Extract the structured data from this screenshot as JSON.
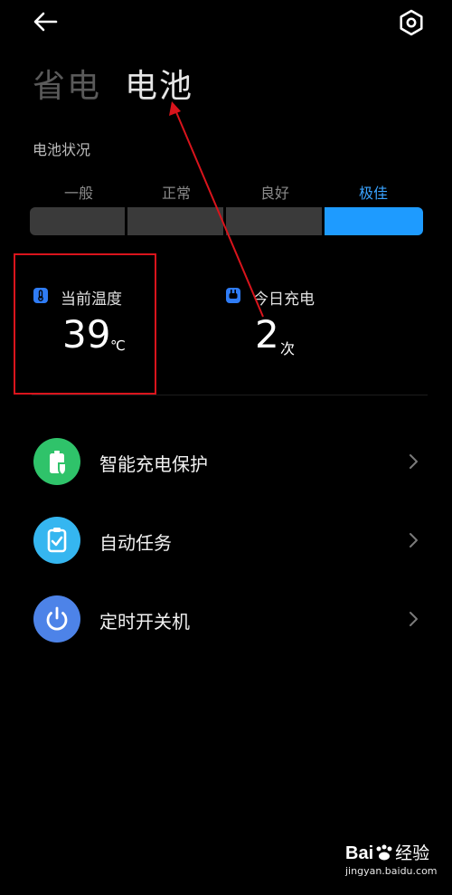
{
  "header": {
    "back_icon": "back-arrow-icon",
    "settings_icon": "gear-icon"
  },
  "tabs": [
    {
      "label": "省电",
      "active": false
    },
    {
      "label": "电池",
      "active": true
    }
  ],
  "battery_status": {
    "label": "电池状况",
    "levels": [
      "一般",
      "正常",
      "良好",
      "极佳"
    ],
    "selected": "极佳",
    "accent_color": "#1e9bff"
  },
  "stats": {
    "temperature": {
      "label": "当前温度",
      "value": "39",
      "unit": "℃",
      "icon": "thermometer-icon"
    },
    "charges": {
      "label": "今日充电",
      "value": "2",
      "unit": "次",
      "icon": "plug-icon"
    }
  },
  "menu": [
    {
      "label": "智能充电保护",
      "icon": "battery-shield-icon",
      "icon_color": "#2fc36a"
    },
    {
      "label": "自动任务",
      "icon": "clipboard-check-icon",
      "icon_color": "#35b6f0"
    },
    {
      "label": "定时开关机",
      "icon": "power-icon",
      "icon_color": "#4d83e8"
    }
  ],
  "watermark": {
    "brand": "Bai",
    "brand_suffix": "经验",
    "url": "jingyan.baidu.com"
  }
}
